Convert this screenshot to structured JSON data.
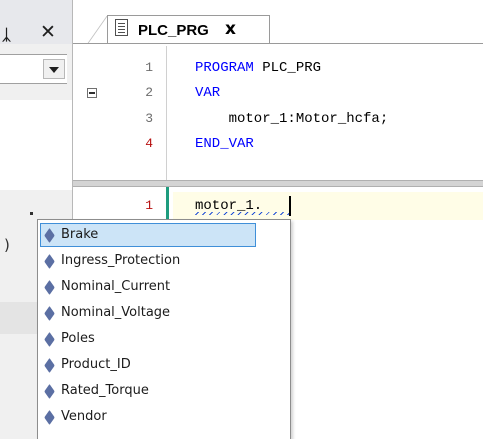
{
  "left_pane": {
    "pin_glyph": "⨆",
    "close_glyph": "✕",
    "stub_text": ")"
  },
  "editor": {
    "tab": {
      "label": "PLC_PRG",
      "close_glyph": "x"
    },
    "declaration": [
      {
        "line": "1",
        "keyword": "PROGRAM",
        "text": " PLC_PRG"
      },
      {
        "line": "2",
        "keyword": "VAR",
        "text": ""
      },
      {
        "line": "3",
        "keyword": "",
        "text": "    motor_1:Motor_hcfa;"
      },
      {
        "line": "4",
        "keyword": "END_VAR",
        "text": ""
      }
    ],
    "body": [
      {
        "line": "1",
        "text": "motor_1."
      }
    ]
  },
  "autocomplete": {
    "selected_index": 0,
    "items": [
      "Brake",
      "Ingress_Protection",
      "Nominal_Current",
      "Nominal_Voltage",
      "Poles",
      "Product_ID",
      "Rated_Torque",
      "Vendor"
    ]
  },
  "colors": {
    "keyword": "#0000ff",
    "line_number": "#6d6d6d",
    "active_line_number": "#b70f0f",
    "selection": "#cce4f7"
  }
}
